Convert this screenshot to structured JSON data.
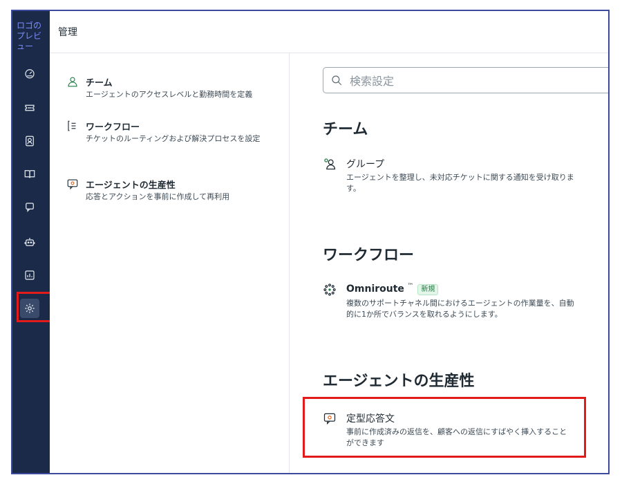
{
  "sidebar": {
    "logo_alt": "ロゴのプレビュー",
    "items": [
      {
        "icon": "speedometer-icon"
      },
      {
        "icon": "ticket-icon"
      },
      {
        "icon": "contact-card-icon"
      },
      {
        "icon": "book-icon"
      },
      {
        "icon": "chat-bubble-icon"
      },
      {
        "icon": "robot-icon"
      },
      {
        "icon": "reports-icon"
      },
      {
        "icon": "gear-icon"
      }
    ],
    "tooltip": "管理"
  },
  "header": {
    "title": "管理"
  },
  "left_panel": {
    "items": [
      {
        "title": "チーム",
        "description": "エージェントのアクセスレベルと勤務時間を定義",
        "icon": "user-icon"
      },
      {
        "title": "ワークフロー",
        "description": "チケットのルーティングおよび解決プロセスを設定",
        "icon": "workflow-icon"
      },
      {
        "title": "エージェントの生産性",
        "description": "応答とアクションを事前に作成して再利用",
        "icon": "canned-response-icon"
      }
    ]
  },
  "main": {
    "search_placeholder": "検索設定",
    "sections": [
      {
        "title": "チーム",
        "cards": [
          {
            "title": "グループ",
            "description": "エージェントを整理し、未対応チケットに関する通知を受け取ります。",
            "icon": "group-icon"
          }
        ]
      },
      {
        "title": "ワークフロー",
        "cards": [
          {
            "title": "Omniroute",
            "trademark": "™",
            "badge": "新規",
            "description": "複数のサポートチャネル間におけるエージェントの作業量を、自動的に1か所でバランスを取れるようにします。",
            "icon": "omniroute-icon"
          }
        ]
      },
      {
        "title": "エージェントの生産性",
        "cards": [
          {
            "title": "定型応答文",
            "description": "事前に作成済みの返信を、顧客への返信にすばやく挿入することができます",
            "icon": "canned-response-icon"
          }
        ]
      }
    ]
  },
  "colors": {
    "sidebar_bg": "#1b2a48",
    "highlight": "#e21a1a",
    "icon_green": "#1f7a43",
    "badge_bg": "#e4f6ea"
  }
}
